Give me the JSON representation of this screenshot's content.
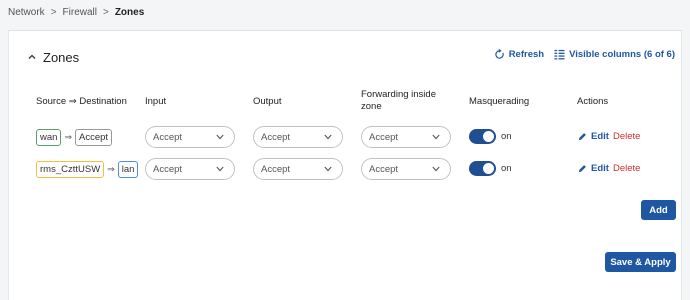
{
  "breadcrumb": {
    "items": [
      "Network",
      "Firewall",
      "Zones"
    ]
  },
  "section": {
    "title": "Zones",
    "refresh_label": "Refresh",
    "visible_columns_label": "Visible columns (6 of 6)"
  },
  "table": {
    "headers": {
      "source_destination": "Source ⇒ Destination",
      "input": "Input",
      "output": "Output",
      "forwarding_line1": "Forwarding inside",
      "forwarding_line2": "zone",
      "masquerading": "Masquerading",
      "actions": "Actions"
    },
    "rows": [
      {
        "source": "wan",
        "arrow": "⇒",
        "destination": "Accept",
        "input": "Accept",
        "output": "Accept",
        "forwarding": "Accept",
        "masquerading": "on",
        "edit": "Edit",
        "delete": "Delete"
      },
      {
        "source": "rms_CzttUSW",
        "arrow": "⇒",
        "destination": "lan",
        "input": "Accept",
        "output": "Accept",
        "forwarding": "Accept",
        "masquerading": "on",
        "edit": "Edit",
        "delete": "Delete"
      }
    ]
  },
  "buttons": {
    "add": "Add",
    "save_apply": "Save & Apply"
  },
  "icons": {
    "collapse": "chevron-up-icon",
    "refresh": "refresh-icon",
    "columns": "columns-icon",
    "edit": "pencil-icon",
    "dropdown": "chevron-down-icon"
  },
  "colors": {
    "accent": "#1f57a3",
    "danger": "#d0302c",
    "toggle_on": "#1f4e91"
  }
}
